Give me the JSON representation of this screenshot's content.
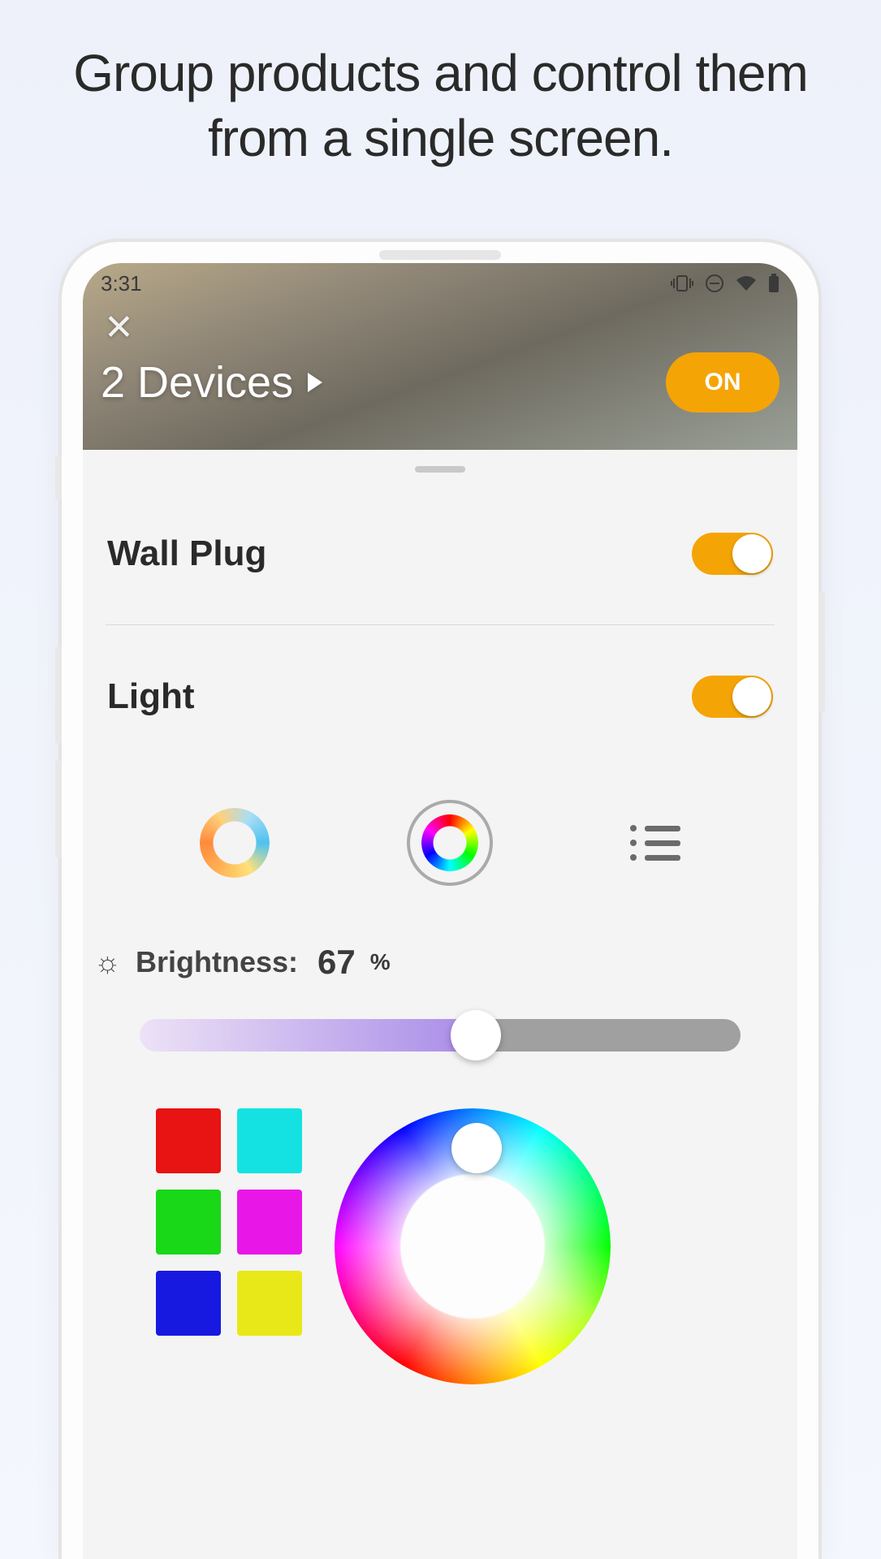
{
  "promo": "Group products and control them from a single screen.",
  "status": {
    "time": "3:31"
  },
  "header": {
    "title": "2 Devices",
    "on_label": "ON"
  },
  "devices": [
    {
      "name": "Wall Plug",
      "on": true
    },
    {
      "name": "Light",
      "on": true
    }
  ],
  "brightness": {
    "label": "Brightness:",
    "value": "67",
    "unit": "%",
    "percent": 56
  },
  "swatches": [
    "#e81313",
    "#14e2e2",
    "#18d818",
    "#e817e8",
    "#1719e1",
    "#e8e818"
  ],
  "colors": {
    "accent": "#f5a406"
  }
}
